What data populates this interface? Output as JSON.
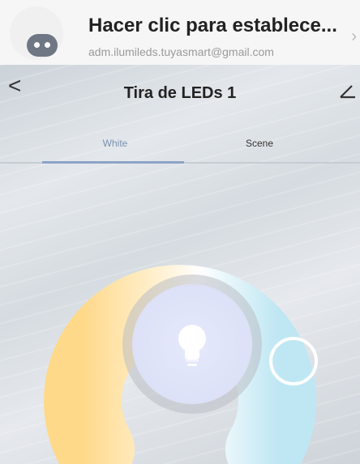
{
  "account": {
    "title": "Hacer clic para establece...",
    "email": "adm.ilumileds.tuyasmart@gmail.com",
    "chevron": "›"
  },
  "header": {
    "back": "<",
    "title": "Tira de LEDs 1"
  },
  "tabs": [
    {
      "label": "White",
      "selected": true
    },
    {
      "label": "Scene",
      "selected": false
    }
  ],
  "icons": {
    "avatar": "robot-avatar-icon",
    "back": "chevron-left-icon",
    "edit": "pencil-icon",
    "bulb": "light-bulb-icon"
  },
  "colors": {
    "warm": "#ffd98a",
    "neutral": "#ffffff",
    "cool": "#bfe7f3",
    "tab_active": "#8da3c7"
  },
  "color_temperature": {
    "thumb_position": "cool end",
    "level_fraction": 0.85
  }
}
